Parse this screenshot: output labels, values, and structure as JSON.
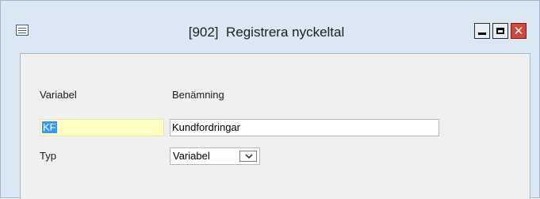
{
  "window": {
    "title": "[902]  Registrera nyckeltal",
    "icons": {
      "system": "window-menu-icon",
      "minimize": "minimize-icon",
      "maximize": "maximize-icon",
      "close": "close-icon"
    },
    "colors": {
      "frame": "#dbe8f4",
      "client": "#f0f0f0",
      "close_button": "#cf4a3a",
      "required_field": "#ffffc4",
      "selection": "#3399ff"
    }
  },
  "form": {
    "labels": {
      "variable": "Variabel",
      "name": "Benämning",
      "type": "Typ"
    },
    "fields": {
      "variable_value": "KF",
      "name_value": "Kundfordringar",
      "type_selected": "Variabel"
    }
  }
}
